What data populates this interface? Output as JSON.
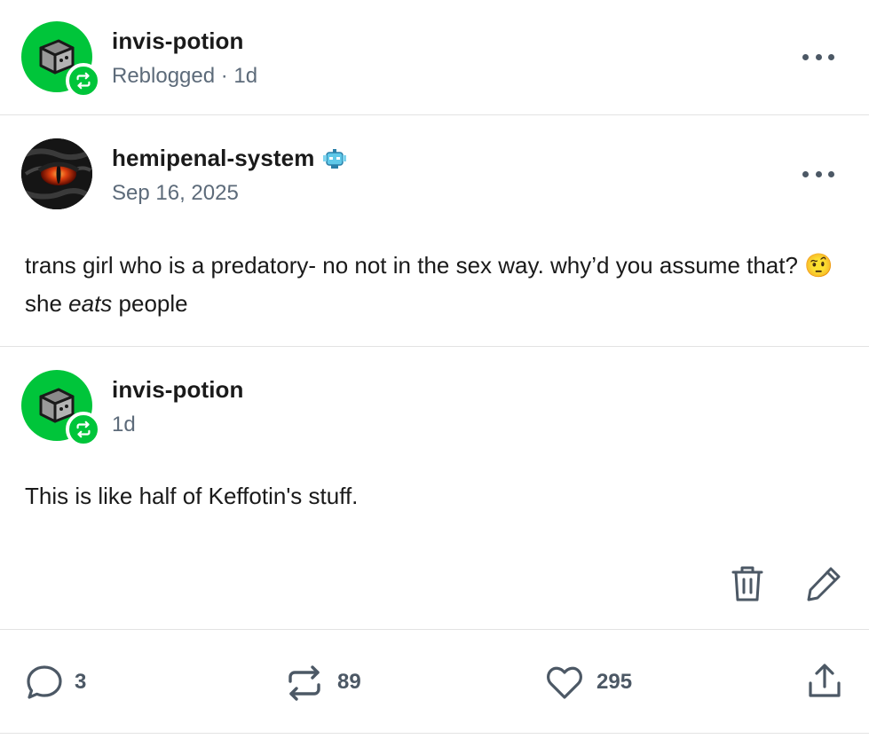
{
  "reblogger": {
    "username": "invis-potion",
    "status": "Reblogged · 1d"
  },
  "original_post": {
    "username": "hemipenal-system",
    "date": "Sep 16, 2025",
    "text_before_emoji": "trans girl who is a predatory- no not in the sex way. why’d you assume that?",
    "emoji": "🤨",
    "text_she": "she",
    "text_eats": "eats",
    "text_people": "people"
  },
  "reply_post": {
    "username": "invis-potion",
    "time": "1d",
    "text": "This is like half of Keffotin's stuff."
  },
  "footer": {
    "comments_count": "3",
    "reblogs_count": "89",
    "likes_count": "295"
  },
  "colors": {
    "accent_green": "#00c53a",
    "text_muted": "#5d6b7a",
    "icon_gray": "#4c5865"
  }
}
